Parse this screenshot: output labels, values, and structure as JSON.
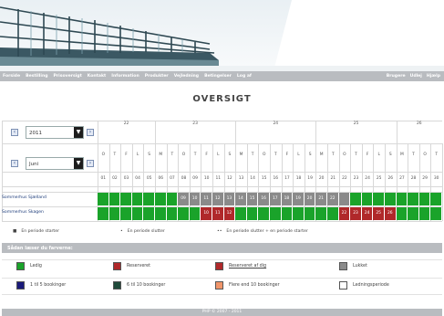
{
  "nav": {
    "left": [
      "Forside",
      "Bestilling",
      "Prisoversigt",
      "Kontakt",
      "Information",
      "Produkter",
      "Vejledning",
      "Betingelser",
      "Log af"
    ],
    "right": [
      "Brugere",
      "Udlej",
      "Hjælp"
    ]
  },
  "title": "OVERSIGT",
  "controls": {
    "year": "2011",
    "month": "Juni"
  },
  "weeks": [
    "22",
    "23",
    "24",
    "25",
    "26"
  ],
  "weekdays": [
    "O",
    "T",
    "F",
    "L",
    "S",
    "M",
    "T",
    "O",
    "T",
    "F",
    "L",
    "S",
    "M",
    "T",
    "O",
    "T",
    "F",
    "L",
    "S",
    "M",
    "T",
    "O",
    "T",
    "F",
    "L",
    "S",
    "M",
    "T",
    "O",
    "T"
  ],
  "dates": [
    "01",
    "02",
    "03",
    "04",
    "05",
    "06",
    "07",
    "08",
    "09",
    "10",
    "11",
    "12",
    "13",
    "14",
    "15",
    "16",
    "17",
    "18",
    "19",
    "20",
    "21",
    "22",
    "23",
    "24",
    "25",
    "26",
    "27",
    "28",
    "29",
    "30"
  ],
  "rows": [
    {
      "label": "Sommerhus Sjælland",
      "cells": [
        "g",
        "g",
        "g",
        "g",
        "g",
        "g",
        "g",
        "k",
        "k",
        "k",
        "k",
        "k",
        "k",
        "k",
        "k",
        "k",
        "k",
        "k",
        "k",
        "k",
        "k",
        "k",
        "g",
        "g",
        "g",
        "g",
        "g",
        "g",
        "g",
        "g"
      ],
      "labels": [
        "",
        "",
        "",
        "",
        "",
        "",
        "",
        "09",
        "10",
        "11",
        "12",
        "13",
        "14",
        "15",
        "16",
        "17",
        "18",
        "19",
        "20",
        "21",
        "22",
        "",
        "",
        "",
        "",
        "",
        "",
        "",
        "",
        ""
      ]
    },
    {
      "label": "Sommerhus Skagen",
      "cells": [
        "g",
        "g",
        "g",
        "g",
        "g",
        "g",
        "g",
        "g",
        "g",
        "r",
        "r",
        "r",
        "g",
        "g",
        "g",
        "g",
        "g",
        "g",
        "g",
        "g",
        "g",
        "r",
        "r",
        "r",
        "r",
        "r",
        "g",
        "g",
        "g",
        "g"
      ],
      "labels": [
        "",
        "",
        "",
        "",
        "",
        "",
        "",
        "",
        "",
        "10",
        "11",
        "12",
        "",
        "",
        "",
        "",
        "",
        "",
        "",
        "",
        "",
        "22",
        "23",
        "24",
        "25",
        "26",
        "",
        "",
        "",
        ""
      ]
    }
  ],
  "legend_symbols": [
    {
      "mark": "■",
      "text": "En periode starter"
    },
    {
      "mark": "•",
      "text": "En periode slutter"
    },
    {
      "mark": "••",
      "text": "En periode slutter + en periode starter"
    }
  ],
  "key_section_title": "Sådan læser du farverne:",
  "keys": [
    {
      "label": "Ledig",
      "color": "#1aa32a"
    },
    {
      "label": "Reserveret",
      "color": "#b0282a"
    },
    {
      "label": "Reserveret af dig",
      "color": "#b0282a"
    },
    {
      "label": "Lukket",
      "color": "#8a8a8a"
    },
    {
      "label": "1 til 5 bookinger",
      "color": "#1a1a7a"
    },
    {
      "label": "6 til 10 bookinger",
      "color": "#1f4a3a"
    },
    {
      "label": "Flere end 10 bookinger",
      "color": "#f0956a"
    },
    {
      "label": "Ledningsperiode",
      "color": "#ffffff"
    }
  ],
  "footer": "PHP © 2007 - 2011",
  "colors": {
    "green": "#1aa32a",
    "red": "#b0282a",
    "grey": "#8a8a8a",
    "nav": "#b9bcc0"
  }
}
